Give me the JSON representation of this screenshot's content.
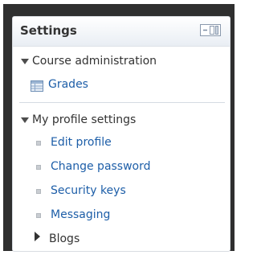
{
  "block": {
    "title": "Settings",
    "dock_icon": "dock-icon"
  },
  "course_admin": {
    "label": "Course administration",
    "expanded": true,
    "items": [
      {
        "label": "Grades",
        "icon": "grades-table-icon"
      }
    ]
  },
  "profile_settings": {
    "label": "My profile settings",
    "expanded": true,
    "items": [
      {
        "label": "Edit profile"
      },
      {
        "label": "Change password"
      },
      {
        "label": "Security keys"
      },
      {
        "label": "Messaging"
      }
    ],
    "blogs": {
      "label": "Blogs",
      "expanded": false
    }
  },
  "colors": {
    "link": "#1d5ea8",
    "text": "#333333",
    "frame": "#2f2f2f"
  }
}
